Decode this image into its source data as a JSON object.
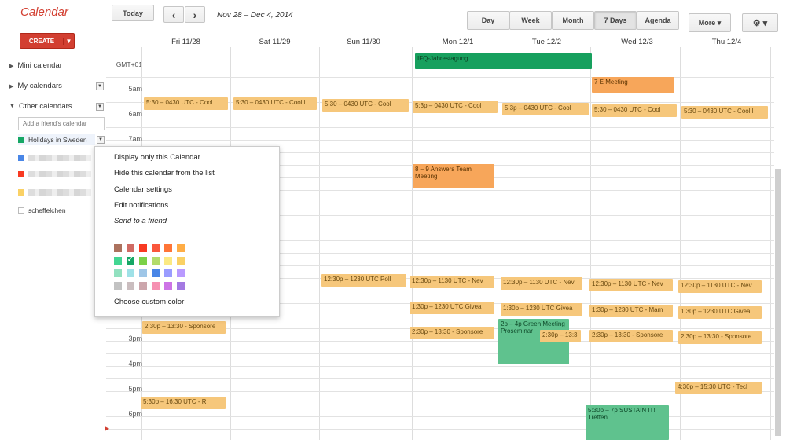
{
  "app_title": "Calendar",
  "toolbar": {
    "today_label": "Today",
    "prev_icon": "‹",
    "next_icon": "›",
    "date_range": "Nov 28 – Dec 4, 2014",
    "views": {
      "day": "Day",
      "week": "Week",
      "month": "Month",
      "seven_days": "7 Days",
      "agenda": "Agenda"
    },
    "selected_view": "7 Days",
    "more_label": "More ▾",
    "settings_icon": "⚙ ▾"
  },
  "sidebar": {
    "create_label": "CREATE",
    "create_drop": "▼",
    "mini_calendar": "Mini calendar",
    "my_calendars": "My calendars",
    "other_calendars": "Other calendars",
    "friend_placeholder": "Add a friend's calendar",
    "holidays": "Holidays in Sweden",
    "holidays_color": "#16a765",
    "cal_colors": [
      "#4986e7",
      "#f83a22",
      "#fad165"
    ],
    "unchecked_cal": "scheffelchen"
  },
  "calendar": {
    "timezone": "GMT+01",
    "days": [
      "Fri 11/28",
      "Sat 11/29",
      "Sun 11/30",
      "Mon 12/1",
      "Tue 12/2",
      "Wed 12/3",
      "Thu 12/4"
    ],
    "hours": [
      "5am",
      "6am",
      "7am",
      "3pm",
      "4pm",
      "5pm",
      "6pm"
    ],
    "all_day_event": "IFQ-Jahrestagung",
    "events": {
      "e_early_wed": "7 E Meeting",
      "e_0530": "5:30 – 0430 UTC - Cool",
      "e_0530b": "5:30 – 0430 UTC - Cool l",
      "e_0530_sun": "5:30 – 0430 UTC - Cool",
      "e_0530_mon": "5:3p – 0430 UTC - Cool",
      "e_0530_thu": "5:30 – 0430 UTC - Cool l",
      "e_answers": "8 – 9 Answers Team Meeting",
      "e_1230_sun": "12:30p – 1230 UTC Poll",
      "e_1230_mon": "12:30p – 1130 UTC - Nev",
      "e_1230_tue": "12:30p – 1130 UTC - Nev",
      "e_1230_wed": "12:30p – 1130 UTC - Nev",
      "e_1230_thu": "12:30p – 1130 UTC - Nev",
      "e_giveaway_mon": "1:30p – 1230 UTC Givea",
      "e_giveaway_tue": "1:30p – 1230 UTC Givea",
      "e_main_wed": "1:30p – 1230 UTC - Mam",
      "e_giveaway_thu": "1:30p – 1230 UTC Givea",
      "e_sponsor_fri": "2:30p – 13:30 - Sponsore",
      "e_sponsor_mon": "2:30p – 13:30 - Sponsore",
      "e_green_tue": "2p – 4p Green Meeting Proseminar",
      "e_sponsor_tue2": "2:30p – 13:3",
      "e_sponsor_wed": "2:30p – 13:30 - Sponsore",
      "e_sponsor_thu": "2:30p – 13:30 - Sponsore",
      "e_tech_thu": "4:30p – 15:30 UTC - Tecl",
      "e_fri_1630": "5:30p – 16:30 UTC - R",
      "e_sustain": "5:30p – 7p SUSTAIN IT! Treffen"
    }
  },
  "popup": {
    "display_only": "Display only this Calendar",
    "hide": "Hide this calendar from the list",
    "settings": "Calendar settings",
    "notifications": "Edit notifications",
    "send": "Send to a friend",
    "choose_color": "Choose custom color",
    "palette": [
      "#ac725e",
      "#d06b64",
      "#f83a22",
      "#fa573c",
      "#ff7537",
      "#ffad46",
      "#42d692",
      "#16a765",
      "#7bd148",
      "#b3dc6c",
      "#fbe983",
      "#fad165",
      "#92e1c0",
      "#9fe1e7",
      "#9fc6e7",
      "#4986e7",
      "#9a9cff",
      "#b99aff",
      "#c2c2c2",
      "#cabdbf",
      "#cca6ac",
      "#f691b2",
      "#cd74e6",
      "#a47ae2"
    ],
    "selected_index": 7
  }
}
